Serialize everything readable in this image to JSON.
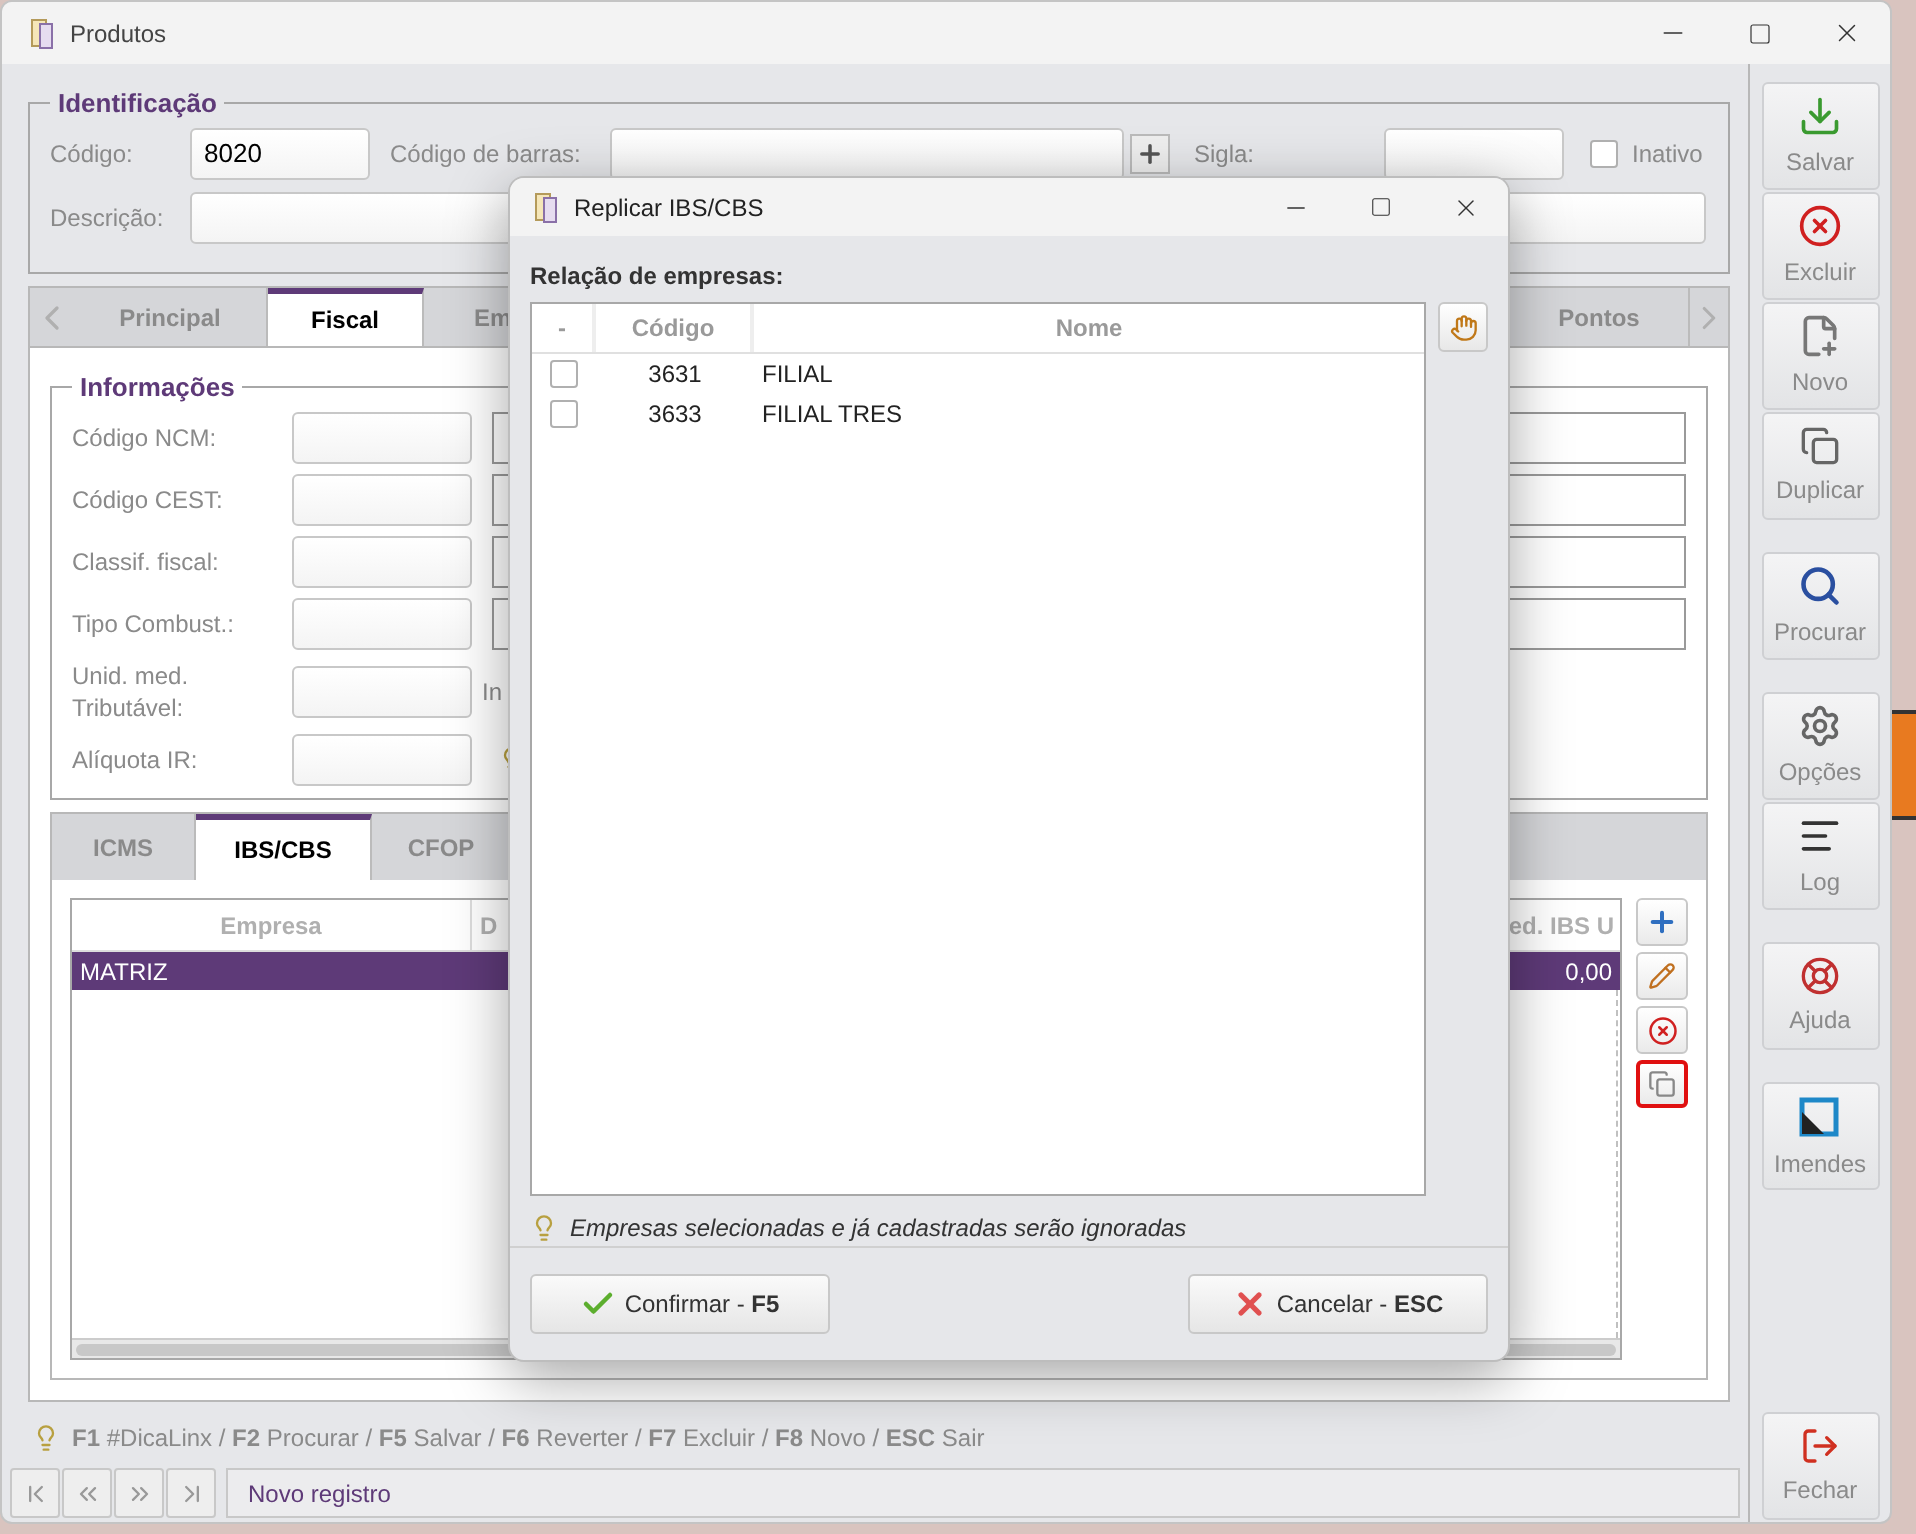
{
  "window": {
    "title": "Produtos"
  },
  "identificacao": {
    "legend": "Identificação",
    "code_label": "Código:",
    "code_value": "8020",
    "barcode_label": "Código de barras:",
    "sigla_label": "Sigla:",
    "inactive": {
      "label": "Inativo",
      "checked": false
    },
    "description_label": "Descrição:"
  },
  "tabs": [
    {
      "label": "Principal",
      "selected": false
    },
    {
      "label": "Fiscal",
      "selected": true
    },
    {
      "label": "Em",
      "selected": false
    },
    {
      "label": "Pontos",
      "selected": false
    }
  ],
  "informacoes": {
    "legend": "Informações",
    "rows": [
      {
        "label": "Código NCM:",
        "kind": "input"
      },
      {
        "label": "Código CEST:",
        "kind": "input"
      },
      {
        "label": "Classif. fiscal:",
        "kind": "input"
      },
      {
        "label": "Tipo Combust.:",
        "kind": "input"
      },
      {
        "label": "Unid. med. Tributável:",
        "kind": "text",
        "side_label": "In"
      },
      {
        "label": "Alíquota IR:",
        "kind": "hint"
      }
    ]
  },
  "subtabs": [
    {
      "label": "ICMS",
      "selected": false
    },
    {
      "label": "IBS/CBS",
      "selected": true
    },
    {
      "label": "CFOP",
      "selected": false
    }
  ],
  "grid": {
    "columns": [
      "Empresa",
      "D",
      "ed. IBS U"
    ],
    "rows": [
      {
        "empresa": "MATRIZ",
        "value": "0,00",
        "selected": true
      }
    ]
  },
  "grid_actions": [
    {
      "kind": "add",
      "highlighted": false
    },
    {
      "kind": "edit",
      "highlighted": false
    },
    {
      "kind": "delete",
      "highlighted": false
    },
    {
      "kind": "copy",
      "highlighted": true
    }
  ],
  "hint_bar": {
    "text": "**F1** #DicaLinx / **F2** Procurar / **F5** Salvar / **F6** Reverter / **F7** Excluir / **F8** Novo / **ESC** Sair"
  },
  "status_bar": {
    "text": "Novo registro"
  },
  "toolbar_groups": [
    [
      {
        "kind": "save",
        "label": "Salvar"
      },
      {
        "kind": "delete",
        "label": "Excluir"
      },
      {
        "kind": "new",
        "label": "Novo"
      },
      {
        "kind": "duplicate",
        "label": "Duplicar"
      }
    ],
    [
      {
        "kind": "search",
        "label": "Procurar"
      }
    ],
    [
      {
        "kind": "options",
        "label": "Opções"
      },
      {
        "kind": "log",
        "label": "Log"
      }
    ],
    [
      {
        "kind": "help",
        "label": "Ajuda"
      }
    ],
    [
      {
        "kind": "imendes",
        "label": "Imendes"
      }
    ]
  ],
  "close_button": {
    "label": "Fechar"
  },
  "dialog": {
    "title": "Replicar IBS/CBS",
    "list_label": "Relação de empresas:",
    "columns": [
      "-",
      "Código",
      "Nome"
    ],
    "rows": [
      {
        "checked": false,
        "code": "3631",
        "name": "FILIAL"
      },
      {
        "checked": false,
        "code": "3633",
        "name": "FILIAL TRES"
      }
    ],
    "hint": "Empresas selecionadas e já cadastradas serão ignoradas",
    "buttons": [
      {
        "kind": "confirm",
        "label": "Confirmar - **F5**"
      },
      {
        "kind": "cancel",
        "label": "Cancelar - **ESC**"
      }
    ]
  }
}
